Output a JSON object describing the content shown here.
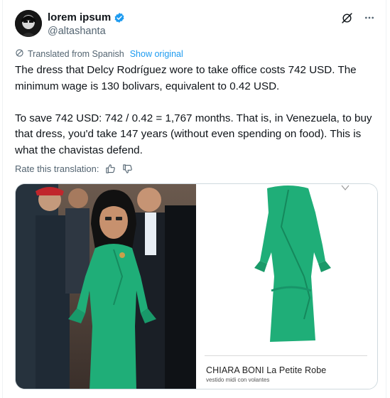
{
  "author": {
    "display_name": "lorem ipsum",
    "handle": "@altashanta"
  },
  "translation": {
    "label": "Translated from Spanish",
    "show_original": "Show original"
  },
  "tweet": {
    "text": "The dress that Delcy Rodríguez wore to take office costs 742 USD. The minimum wage is 130 bolivars, equivalent to 0.42 USD.\n\nTo save 742 USD: 742 / 0.42 = 1,767 months. That is, in Venezuela, to buy that dress, you'd take 147 years (without even spending on food). This is what the chavistas defend."
  },
  "rate": {
    "label": "Rate this translation:"
  },
  "media": {
    "product_brand": "CHIARA BONI La Petite Robe",
    "product_subtitle": "vestido midi con volantes"
  },
  "icons": {
    "verified": "verified-badge-icon",
    "grok": "grok-icon",
    "more": "more-icon",
    "translate": "translate-icon",
    "thumbs_up": "thumbs-up-icon",
    "thumbs_down": "thumbs-down-icon"
  },
  "colors": {
    "accent": "#1d9bf0",
    "dress_green": "#1fae78"
  }
}
